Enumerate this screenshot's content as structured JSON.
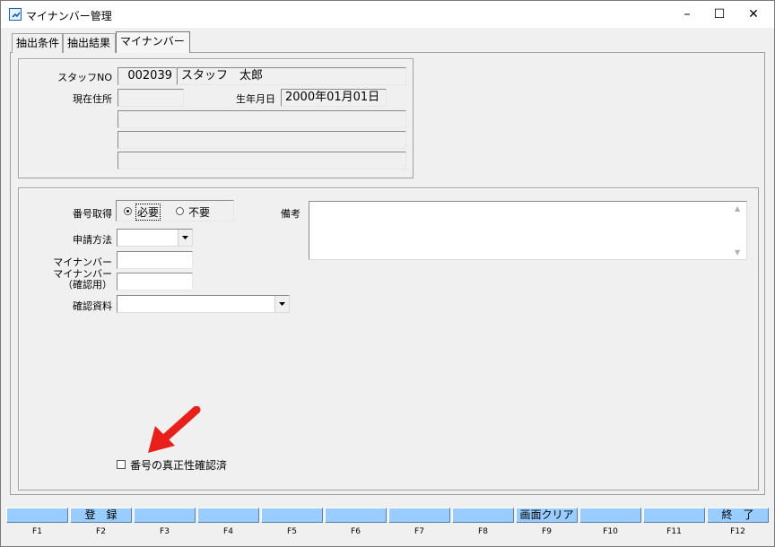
{
  "window": {
    "title": "マイナンバー管理",
    "app_icon": "app-icon",
    "controls": {
      "minimize": "–",
      "maximize": "☐",
      "close": "✕"
    }
  },
  "tabs": [
    {
      "label": "抽出条件",
      "active": false
    },
    {
      "label": "抽出結果",
      "active": false
    },
    {
      "label": "マイナンバー",
      "active": true
    }
  ],
  "staff": {
    "staff_no_label": "スタッフNO",
    "staff_no": "002039",
    "staff_name": "スタッフ　太郎",
    "address_label": "現在住所",
    "address_postal": "",
    "birthdate_label": "生年月日",
    "birthdate": "2000年01月01日",
    "address_line1": "",
    "address_line2": "",
    "address_line3": ""
  },
  "mynumber": {
    "acquire_label": "番号取得",
    "acquire_options": [
      {
        "label": "必要",
        "checked": true
      },
      {
        "label": "不要",
        "checked": false
      }
    ],
    "method_label": "申請方法",
    "method_value": "",
    "number_label": "マイナンバー",
    "number_value": "",
    "number_confirm_label_1": "マイナンバー",
    "number_confirm_label_2": "（確認用）",
    "number_confirm_value": "",
    "document_label": "確認資料",
    "document_value": "",
    "remarks_label": "備考",
    "remarks_value": "",
    "verified_label": "番号の真正性確認済",
    "verified_checked": false
  },
  "annotation": {
    "arrow_color": "#e8201c"
  },
  "function_keys": [
    {
      "key": "F1",
      "label": ""
    },
    {
      "key": "F2",
      "label": "登　録"
    },
    {
      "key": "F3",
      "label": ""
    },
    {
      "key": "F4",
      "label": ""
    },
    {
      "key": "F5",
      "label": ""
    },
    {
      "key": "F6",
      "label": ""
    },
    {
      "key": "F7",
      "label": ""
    },
    {
      "key": "F8",
      "label": ""
    },
    {
      "key": "F9",
      "label": "画面クリア"
    },
    {
      "key": "F10",
      "label": ""
    },
    {
      "key": "F11",
      "label": ""
    },
    {
      "key": "F12",
      "label": "終　了"
    }
  ],
  "colors": {
    "fkey_button": "#99ccff",
    "window_bg": "#f0f0f0"
  }
}
